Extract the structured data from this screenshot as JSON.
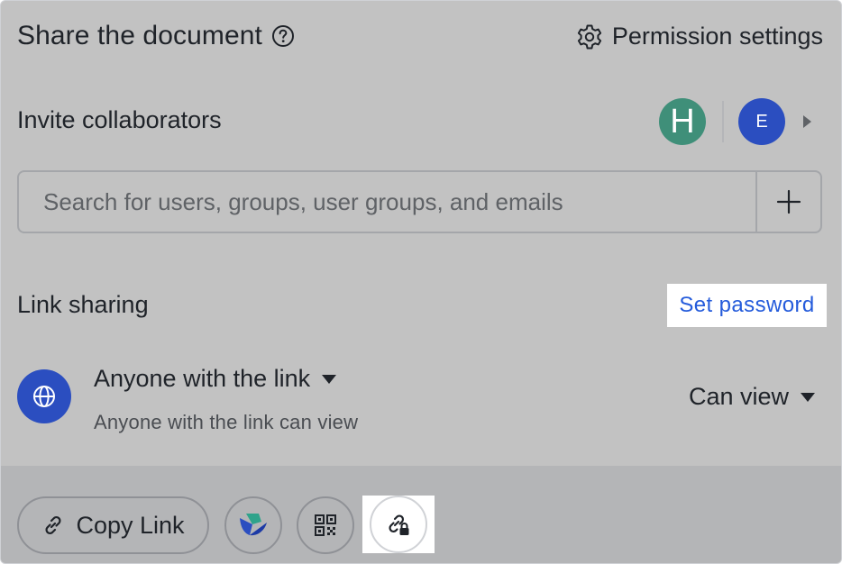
{
  "header": {
    "title": "Share the document",
    "permission_settings_label": "Permission settings"
  },
  "invite": {
    "label": "Invite collaborators",
    "avatars": [
      {
        "initial": "H",
        "color": "#3f8f79"
      },
      {
        "initial": "E",
        "color": "#2b4ec0"
      }
    ]
  },
  "search": {
    "placeholder": "Search for users, groups, user groups, and emails",
    "value": ""
  },
  "link_sharing": {
    "label": "Link sharing",
    "set_password_label": "Set password",
    "scope_label": "Anyone with the link",
    "scope_description": "Anyone with the link can view",
    "permission_label": "Can view"
  },
  "footer": {
    "copy_link_label": "Copy Link",
    "icons": [
      "link-icon",
      "lark-app-icon",
      "qr-code-icon",
      "link-lock-icon"
    ]
  },
  "colors": {
    "accent": "#245bdb",
    "globe_bg": "#2b4ec0",
    "avatar_h": "#3f8f79",
    "avatar_e": "#2b4ec0"
  }
}
